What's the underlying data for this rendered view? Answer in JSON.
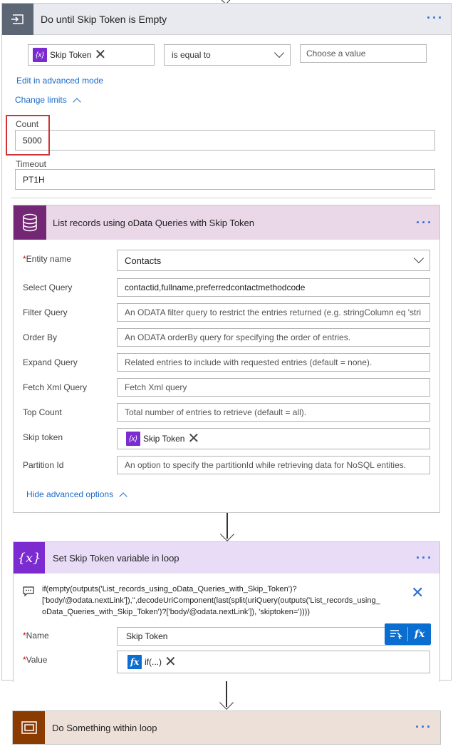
{
  "loop": {
    "title": "Do until Skip Token is Empty",
    "condition": {
      "left_token": "Skip Token",
      "operator": "is equal to",
      "right_placeholder": "Choose a value"
    },
    "edit_advanced_label": "Edit in advanced mode",
    "change_limits_label": "Change limits",
    "count_label": "Count",
    "count_value": "5000",
    "timeout_label": "Timeout",
    "timeout_value": "PT1H"
  },
  "list_action": {
    "title": "List records using oData Queries with Skip Token",
    "fields": {
      "entity_name": {
        "label": "Entity name",
        "value": "Contacts"
      },
      "select_query": {
        "label": "Select Query",
        "value": "contactid,fullname,preferredcontactmethodcode"
      },
      "filter_query": {
        "label": "Filter Query",
        "placeholder": "An ODATA filter query to restrict the entries returned (e.g. stringColumn eq 'stri"
      },
      "order_by": {
        "label": "Order By",
        "placeholder": "An ODATA orderBy query for specifying the order of entries."
      },
      "expand_query": {
        "label": "Expand Query",
        "placeholder": "Related entries to include with requested entries (default = none)."
      },
      "fetch_xml": {
        "label": "Fetch Xml Query",
        "placeholder": "Fetch Xml query"
      },
      "top_count": {
        "label": "Top Count",
        "placeholder": "Total number of entries to retrieve (default = all)."
      },
      "skip_token": {
        "label": "Skip token",
        "token": "Skip Token"
      },
      "partition_id": {
        "label": "Partition Id",
        "placeholder": "An option to specify the partitionId while retrieving data for NoSQL entities."
      }
    },
    "hide_advanced_label": "Hide advanced options"
  },
  "set_action": {
    "title": "Set Skip Token variable in loop",
    "expression_line1": "if(empty(outputs('List_records_using_oData_Queries_with_Skip_Token')?",
    "expression_line2": "['body/@odata.nextLink']),'',decodeUriComponent(last(split(uriQuery(outputs('List_records_using_",
    "expression_line3": "oData_Queries_with_Skip_Token')?['body/@odata.nextLink']), 'skiptoken='))))",
    "name_label": "Name",
    "name_value": "Skip Token",
    "value_label": "Value",
    "value_token": "if(...)",
    "fx_label": "fx"
  },
  "do_action": {
    "title": "Do Something within loop"
  },
  "ellipsis": "···",
  "required_mark": "*",
  "colors": {
    "loop_header": "#5d6675",
    "dataverse_accent": "#742774",
    "variable_accent": "#7b2bd0",
    "control_accent": "#8c3b00",
    "link_blue": "#1a6ac8",
    "highlight_red": "#d13438"
  }
}
